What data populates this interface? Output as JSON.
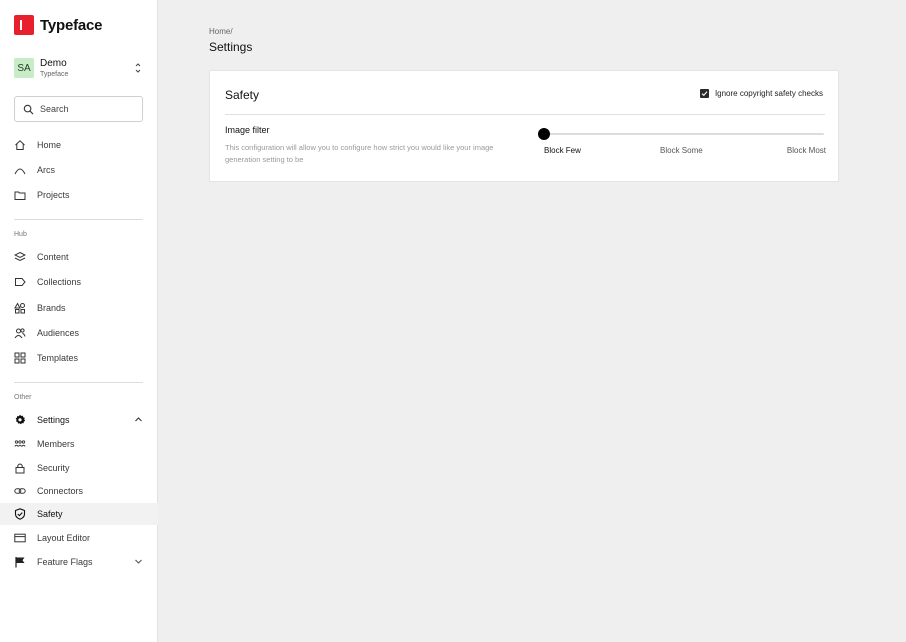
{
  "brand": {
    "name": "Typeface",
    "logo_color": "#e8202e"
  },
  "workspace": {
    "initials": "SA",
    "name": "Demo",
    "org": "Typeface"
  },
  "search": {
    "placeholder": "Search"
  },
  "nav_primary": [
    {
      "label": "Home",
      "icon": "home-icon"
    },
    {
      "label": "Arcs",
      "icon": "arc-icon"
    },
    {
      "label": "Projects",
      "icon": "folder-icon"
    }
  ],
  "hub": {
    "label": "Hub",
    "items": [
      {
        "label": "Content",
        "icon": "layers-icon"
      },
      {
        "label": "Collections",
        "icon": "tag-icon"
      },
      {
        "label": "Brands",
        "icon": "shapes-icon"
      },
      {
        "label": "Audiences",
        "icon": "people-icon"
      },
      {
        "label": "Templates",
        "icon": "grid-icon"
      }
    ]
  },
  "other": {
    "label": "Other",
    "settings_label": "Settings",
    "items": [
      {
        "label": "Members",
        "icon": "members-icon"
      },
      {
        "label": "Security",
        "icon": "lock-icon"
      },
      {
        "label": "Connectors",
        "icon": "link-icon"
      },
      {
        "label": "Safety",
        "icon": "shield-icon",
        "active": true
      },
      {
        "label": "Layout Editor",
        "icon": "layout-icon"
      },
      {
        "label": "Feature Flags",
        "icon": "flag-icon"
      }
    ]
  },
  "page": {
    "breadcrumb": "Home/",
    "title": "Settings"
  },
  "safety_card": {
    "title": "Safety",
    "ignore_checks_label": "Ignore copyright safety checks",
    "ignore_checks_checked": true,
    "filter_title": "Image filter",
    "filter_description": "This configuration will allow you to configure how strict you would like your image generation setting to be",
    "slider_options": [
      "Block Few",
      "Block Some",
      "Block Most"
    ],
    "slider_selected": "Block Few",
    "slider_value": 0
  }
}
